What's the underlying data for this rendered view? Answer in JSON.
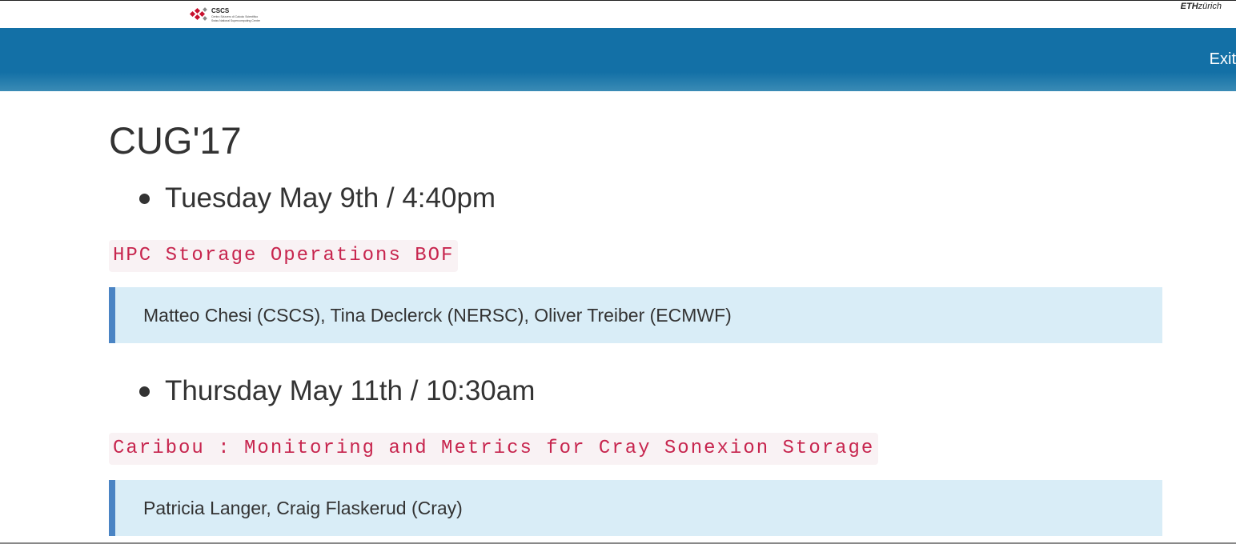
{
  "header": {
    "cscs_logo": {
      "name": "CSCS",
      "line1": "Centro Svizzero di Calcolo Scientifico",
      "line2": "Swiss National Supercomputing Centre"
    },
    "eth_logo": {
      "bold": "ETH",
      "italic": "zürich"
    }
  },
  "navbar": {
    "exit_label": "Exit"
  },
  "main": {
    "title": "CUG'17",
    "sessions": [
      {
        "date": "Tuesday May 9th / 4:40pm",
        "talk": "HPC Storage Operations BOF",
        "speakers": "Matteo Chesi (CSCS), Tina Declerck (NERSC), Oliver Treiber (ECMWF)"
      },
      {
        "date": "Thursday May 11th / 10:30am",
        "talk": "Caribou : Monitoring and Metrics for Cray Sonexion Storage",
        "speakers": "Patricia Langer, Craig Flaskerud (Cray)"
      }
    ]
  },
  "colors": {
    "navbar": "#1370a6",
    "code_text": "#c7254e",
    "code_bg": "#f9f2f4",
    "quote_bg": "#d9edf7",
    "quote_border": "#4a84c4"
  }
}
